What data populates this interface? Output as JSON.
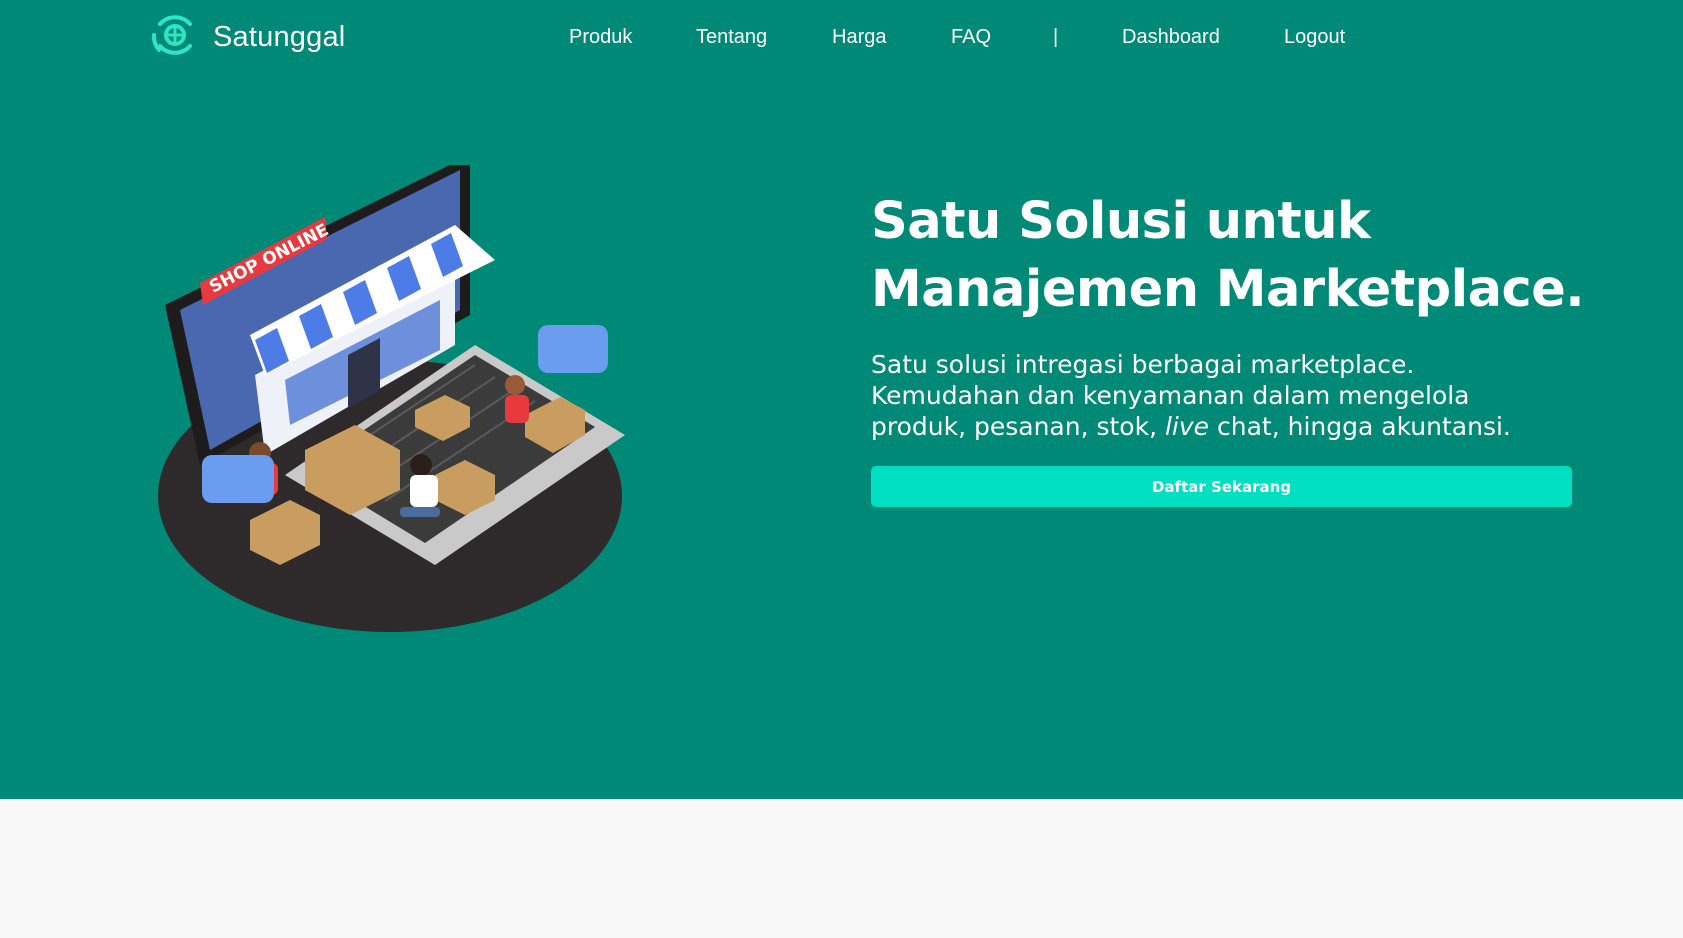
{
  "brand": {
    "name": "Satunggal",
    "logo_icon": "satunggal-logo-icon"
  },
  "nav": {
    "produk": "Produk",
    "tentang": "Tentang",
    "harga": "Harga",
    "faq": "FAQ",
    "separator": "|",
    "dashboard": "Dashboard",
    "logout": "Logout"
  },
  "hero": {
    "title_line1": "Satu Solusi untuk",
    "title_line2": "Manajemen Marketplace.",
    "desc_line1": "Satu solusi intregasi berbagai marketplace.",
    "desc_line2": "Kemudahan dan kenyamanan dalam mengelola",
    "desc_line3_a": "produk, pesanan, stok, ",
    "desc_line3_em": "live",
    "desc_line3_b": " chat, hingga akuntansi.",
    "cta_label": "Daftar Sekarang",
    "illustration_sign": "SHOP ONLINE"
  },
  "colors": {
    "hero_bg": "#008976",
    "accent": "#00dfc0",
    "text": "#ffffff",
    "below_bg": "#f8f8f8"
  }
}
